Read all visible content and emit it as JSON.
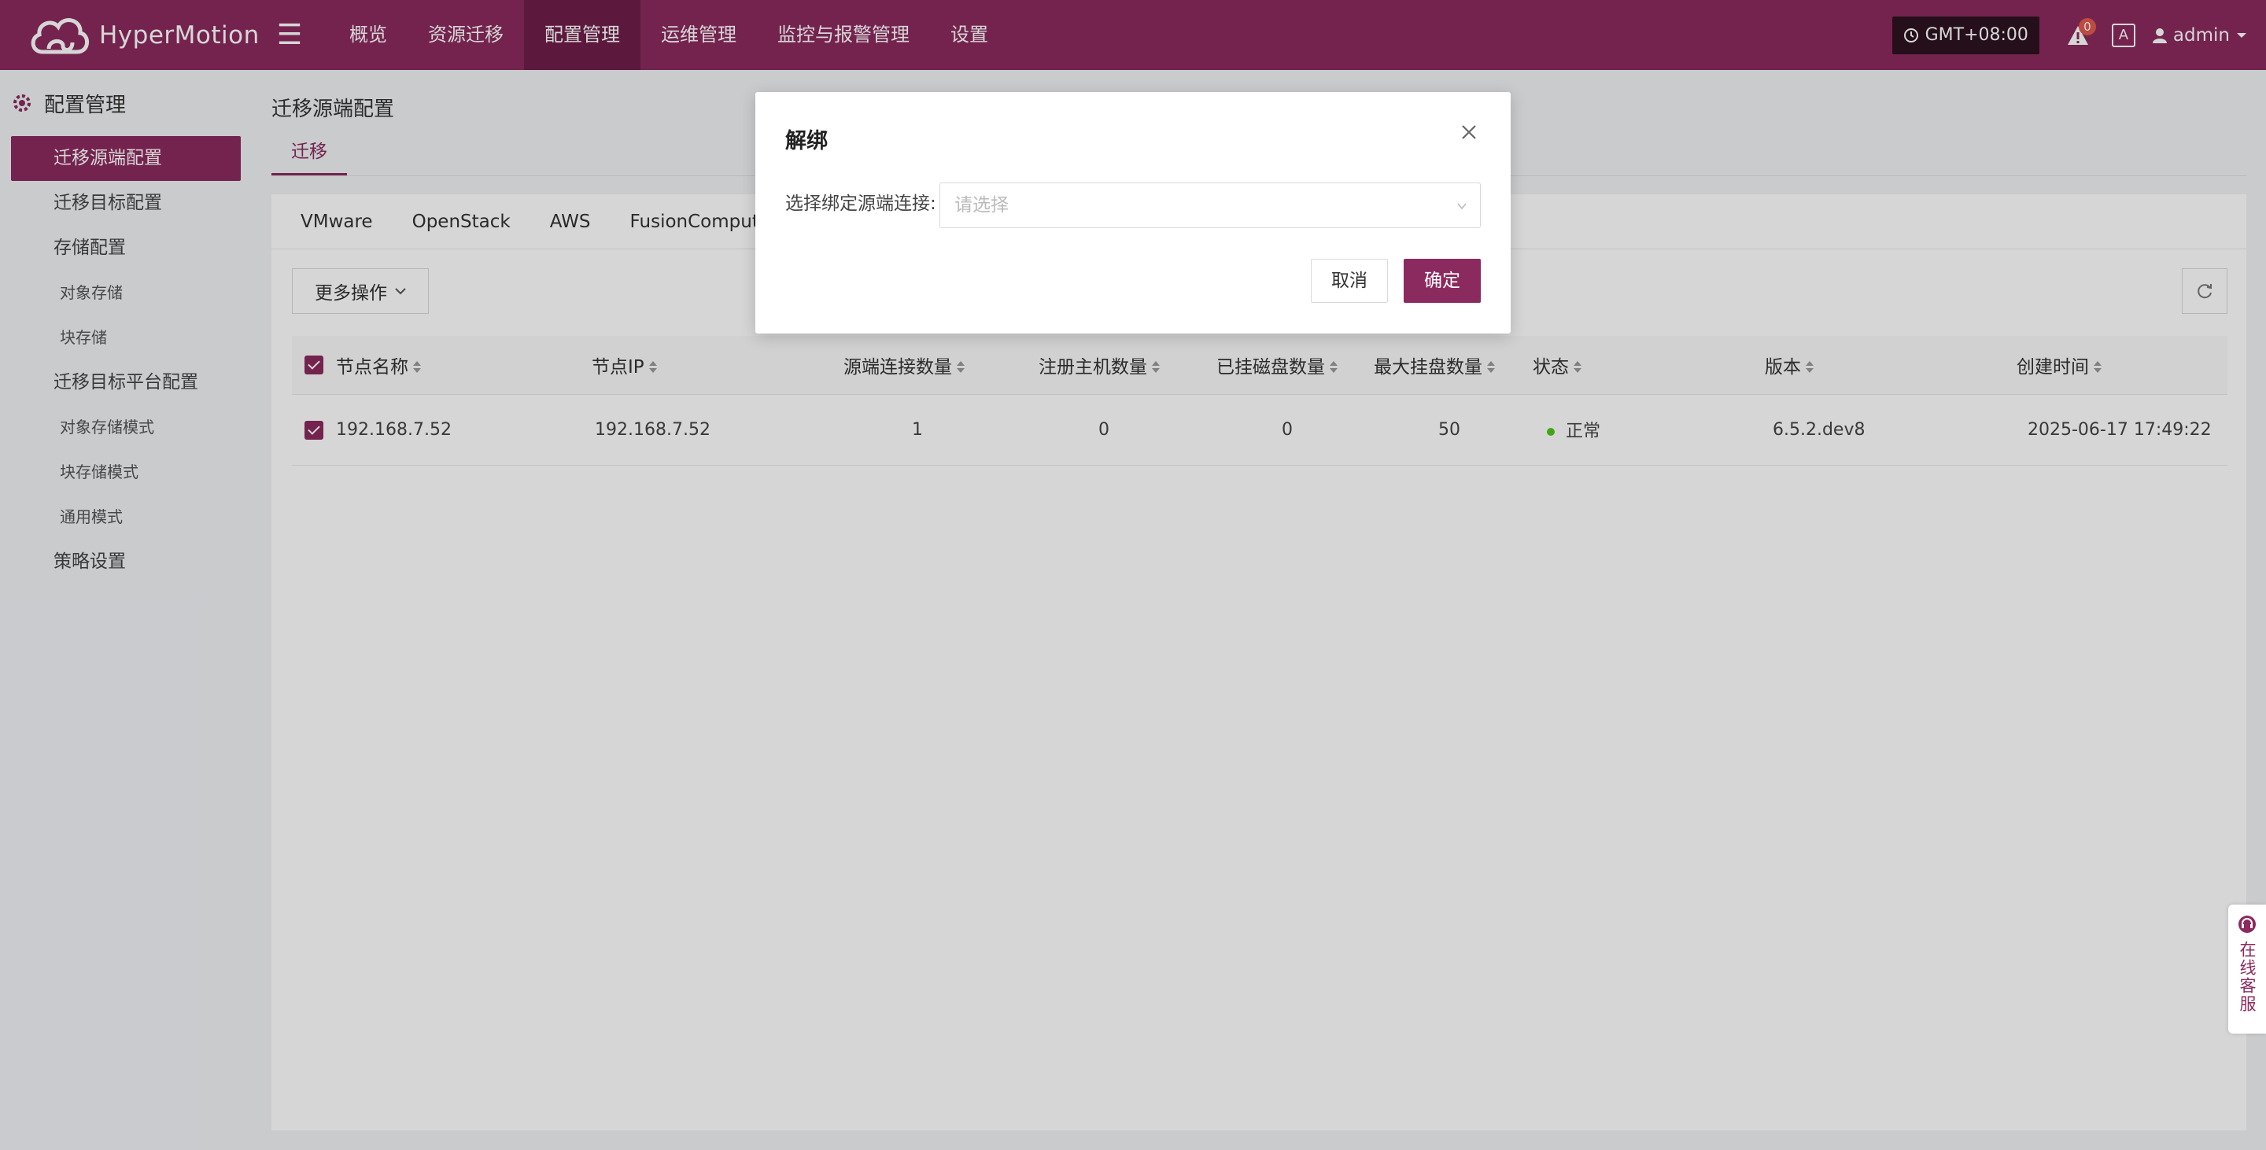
{
  "app": {
    "brand": "HyperMotion",
    "brand_color": "#8b2a5e"
  },
  "topnav": {
    "items": [
      {
        "label": "概览"
      },
      {
        "label": "资源迁移"
      },
      {
        "label": "配置管理"
      },
      {
        "label": "运维管理"
      },
      {
        "label": "监控与报警管理"
      },
      {
        "label": "设置"
      }
    ],
    "active_index": 2,
    "timezone": "GMT+08:00",
    "alert_count": "0",
    "user": "admin"
  },
  "sidebar": {
    "title": "配置管理",
    "items": [
      {
        "label": "迁移源端配置"
      },
      {
        "label": "迁移目标配置"
      },
      {
        "label": "存储配置"
      },
      {
        "label": "对象存储"
      },
      {
        "label": "块存储"
      },
      {
        "label": "迁移目标平台配置"
      },
      {
        "label": "对象存储模式"
      },
      {
        "label": "块存储模式"
      },
      {
        "label": "通用模式"
      },
      {
        "label": "策略设置"
      }
    ]
  },
  "main": {
    "page_title": "迁移源端配置",
    "tab": "迁移",
    "subtabs": [
      "VMware",
      "OpenStack",
      "AWS",
      "FusionCompute"
    ],
    "more_actions": "更多操作",
    "table": {
      "columns": [
        "节点名称",
        "节点IP",
        "源端连接数量",
        "注册主机数量",
        "已挂磁盘数量",
        "最大挂盘数量",
        "状态",
        "版本",
        "创建时间"
      ],
      "rows": [
        {
          "name": "192.168.7.52",
          "ip": "192.168.7.52",
          "source_connections": "1",
          "registered_hosts": "0",
          "mounted_disks": "0",
          "max_disks": "50",
          "status": "正常",
          "version": "6.5.2.dev8",
          "created": "2025-06-17 17:49:22"
        }
      ]
    }
  },
  "modal": {
    "title": "解绑",
    "field_label": "选择绑定源端连接:",
    "select_placeholder": "请选择",
    "cancel": "取消",
    "confirm": "确定"
  },
  "service": {
    "label": "在线客服"
  }
}
